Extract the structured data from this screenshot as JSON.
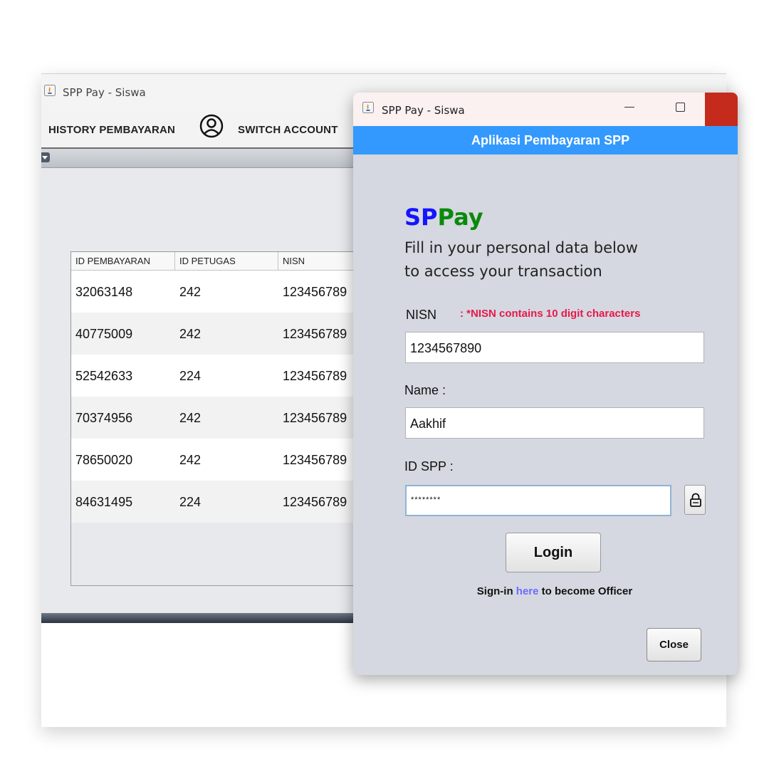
{
  "background_window": {
    "title": "SPP Pay - Siswa",
    "menu": {
      "history": "HISTORY PEMBAYARAN",
      "switch_account": "SWITCH ACCOUNT"
    },
    "table": {
      "columns": [
        "ID PEMBAYARAN",
        "ID PETUGAS",
        "NISN"
      ],
      "rows": [
        [
          "32063148",
          "242",
          "123456789"
        ],
        [
          "40775009",
          "242",
          "123456789"
        ],
        [
          "52542633",
          "224",
          "123456789"
        ],
        [
          "70374956",
          "242",
          "123456789"
        ],
        [
          "78650020",
          "242",
          "123456789"
        ],
        [
          "84631495",
          "224",
          "123456789"
        ]
      ]
    }
  },
  "dialog": {
    "title": "SPP Pay - Siswa",
    "header": "Aplikasi Pembayaran SPP",
    "brand": {
      "part1": "SP",
      "part2": "Pay"
    },
    "intro_line1": "Fill in your personal data below",
    "intro_line2": "to access your transaction",
    "nisn_label": "NISN",
    "nisn_hint": ": *NISN contains 10 digit characters",
    "nisn_value": "1234567890",
    "name_label": "Name  :",
    "name_value": "Aakhif",
    "idspp_label": "ID SPP :",
    "idspp_value": "********",
    "login_label": "Login",
    "signin_prefix": "Sign-in ",
    "signin_link": "here",
    "signin_suffix": " to become Officer",
    "close_label": "Close"
  },
  "colors": {
    "header_blue": "#3399ff",
    "brand_blue": "#1414ff",
    "brand_green": "#0a8a0a",
    "hint_red": "#e8184d",
    "link_blue": "#6b6bff",
    "close_red": "#c42b1c"
  },
  "icons": [
    "java-icon",
    "user-circle-icon",
    "minimize-icon",
    "maximize-icon",
    "close-icon",
    "lock-icon",
    "dropdown-icon"
  ]
}
